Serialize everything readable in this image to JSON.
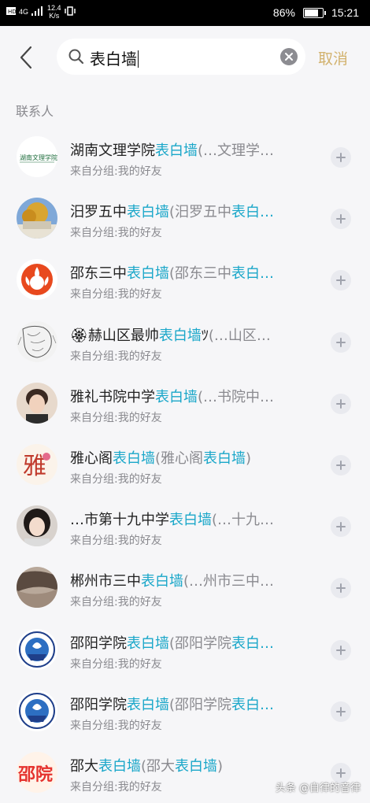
{
  "status_bar": {
    "net_type": "4G",
    "speed_value": "12.4",
    "speed_unit": "K/s",
    "battery": "86%",
    "battery_level": 0.86,
    "time": "15:21"
  },
  "search": {
    "query": "表白墙",
    "cancel_label": "取消"
  },
  "section_title": "联系人",
  "contacts": [
    {
      "name_parts": [
        {
          "t": "湖南文理学院"
        },
        {
          "t": "表白墙",
          "hl": true
        },
        {
          "t": "(…文理学…",
          "muted": true
        }
      ],
      "sub": "来自分组:我的好友",
      "avatar": "logo-calligraphy"
    },
    {
      "name_parts": [
        {
          "t": "汨罗五中"
        },
        {
          "t": "表白墙",
          "hl": true
        },
        {
          "t": "(汨罗五中",
          "muted": true
        },
        {
          "t": "表白…",
          "hl": true
        }
      ],
      "sub": "来自分组:我的好友",
      "avatar": "photo-tree"
    },
    {
      "name_parts": [
        {
          "t": "邵东三中"
        },
        {
          "t": "表白墙",
          "hl": true
        },
        {
          "t": "(邵东三中",
          "muted": true
        },
        {
          "t": "表白…",
          "hl": true
        }
      ],
      "sub": "来自分组:我的好友",
      "avatar": "logo-flame"
    },
    {
      "name_parts": [
        {
          "t": "🏵赫山区最帅"
        },
        {
          "t": "表白墙",
          "hl": true
        },
        {
          "t": "ﾂ",
          "muted": false
        },
        {
          "t": "(…山区…",
          "muted": true
        }
      ],
      "sub": "来自分组:我的好友",
      "avatar": "sketch-face"
    },
    {
      "name_parts": [
        {
          "t": "雅礼书院中学"
        },
        {
          "t": "表白墙",
          "hl": true
        },
        {
          "t": "(…书院中…",
          "muted": true
        }
      ],
      "sub": "来自分组:我的好友",
      "avatar": "photo-person"
    },
    {
      "name_parts": [
        {
          "t": "雅心阁"
        },
        {
          "t": "表白墙",
          "hl": true
        },
        {
          "t": "(雅心阁",
          "muted": true
        },
        {
          "t": "表白墙",
          "hl": true
        },
        {
          "t": ")",
          "muted": true
        }
      ],
      "sub": "来自分组:我的好友",
      "avatar": "logo-calligraphy-red"
    },
    {
      "name_parts": [
        {
          "t": "…市第十九中学"
        },
        {
          "t": "表白墙",
          "hl": true
        },
        {
          "t": "(…十九…",
          "muted": true
        }
      ],
      "sub": "来自分组:我的好友",
      "avatar": "photo-girl"
    },
    {
      "name_parts": [
        {
          "t": "郴州市三中"
        },
        {
          "t": "表白墙",
          "hl": true
        },
        {
          "t": "(…州市三中…",
          "muted": true
        }
      ],
      "sub": "来自分组:我的好友",
      "avatar": "photo-hair"
    },
    {
      "name_parts": [
        {
          "t": "邵阳学院"
        },
        {
          "t": "表白墙",
          "hl": true
        },
        {
          "t": "(邵阳学院",
          "muted": true
        },
        {
          "t": "表白…",
          "hl": true
        }
      ],
      "sub": "来自分组:我的好友",
      "avatar": "logo-emblem"
    },
    {
      "name_parts": [
        {
          "t": "邵阳学院"
        },
        {
          "t": "表白墙",
          "hl": true
        },
        {
          "t": "(邵阳学院",
          "muted": true
        },
        {
          "t": "表白…",
          "hl": true
        }
      ],
      "sub": "来自分组:我的好友",
      "avatar": "logo-emblem"
    },
    {
      "name_parts": [
        {
          "t": "邵大"
        },
        {
          "t": "表白墙",
          "hl": true
        },
        {
          "t": "(邵大",
          "muted": true
        },
        {
          "t": "表白墙",
          "hl": true
        },
        {
          "t": ")",
          "muted": true
        }
      ],
      "sub": "来自分组:我的好友",
      "avatar": "logo-text-red"
    }
  ],
  "watermark": "头条 @自律的音律",
  "colors": {
    "highlight": "#1aa7c9",
    "cancel": "#d2b26e",
    "secondary_text": "#8a8a8f",
    "background": "#f6f6f8"
  }
}
